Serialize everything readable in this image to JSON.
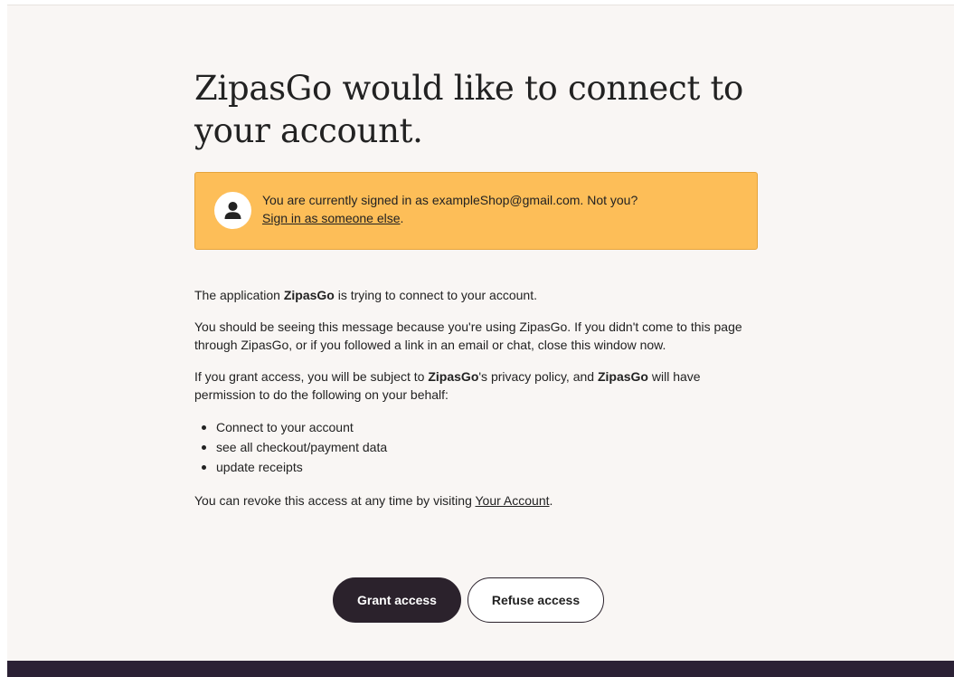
{
  "header": {
    "title": "ZipasGo would like to connect to your account."
  },
  "notice": {
    "icon": "user-icon",
    "text": "You are currently signed in as exampleShop@gmail.com. Not you?",
    "link": "Sign in as someone else",
    "link_suffix": "."
  },
  "body": {
    "app_name": "ZipasGo",
    "intro_prefix": "The application ",
    "intro_suffix": " is trying to connect to your account.",
    "warning": "You should be seeing this message because you're using ZipasGo. If you didn't come to this page through ZipasGo, or if you followed a link in an email or chat, close this window now.",
    "grant_prefix": "If you grant access, you will be subject to ",
    "grant_mid": "'s privacy policy, and ",
    "grant_suffix": " will have permission to do the following on your behalf:",
    "permissions": [
      "Connect to your account",
      "see all checkout/payment data",
      "update receipts"
    ],
    "revoke_prefix": "You can revoke this access at any time by visiting ",
    "revoke_link": "Your Account",
    "revoke_suffix": "."
  },
  "actions": {
    "grant_label": "Grant access",
    "refuse_label": "Refuse access"
  },
  "colors": {
    "notice_bg": "#fdbe58",
    "primary_button": "#2b222c",
    "footer": "#2b2135",
    "page_bg": "#f9f6f4"
  }
}
